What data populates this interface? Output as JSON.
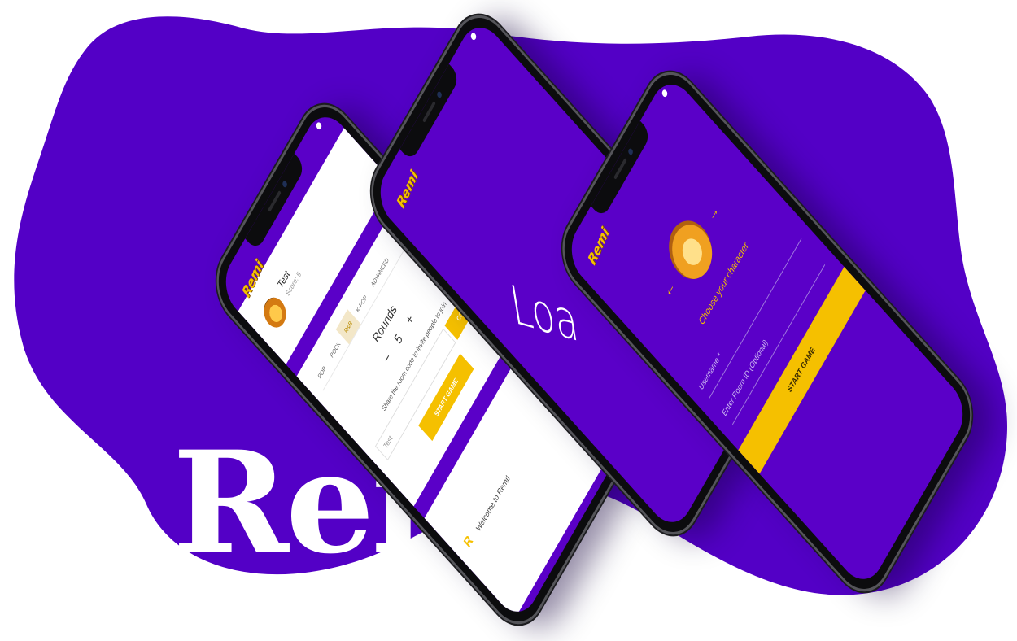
{
  "brand_title": "Remi",
  "app_logo": "Remi",
  "colors": {
    "primary": "#5a00c8",
    "accent": "#f5c000"
  },
  "lobby": {
    "player_name": "Test",
    "player_score": "Score: 5",
    "genre_tabs": [
      "POP",
      "ROCK",
      "R&B",
      "K-POP",
      "ADVANCED"
    ],
    "rounds_label": "Rounds",
    "rounds_minus": "−",
    "rounds_value": "5",
    "rounds_plus": "+",
    "share_text": "Share the room code to invite people to join",
    "room_code": "Test",
    "copy_label": "COPY",
    "start_label": "START GAME",
    "welcome_text": "Welcome to Remi!"
  },
  "loading_screen": {
    "text": "Loa"
  },
  "character_select": {
    "left_arrow": "←",
    "right_arrow": "→",
    "choose_label": "Choose your character",
    "username_placeholder": "Username *",
    "room_placeholder": "Enter Room ID (Optional)",
    "start_label": "START GAME"
  }
}
